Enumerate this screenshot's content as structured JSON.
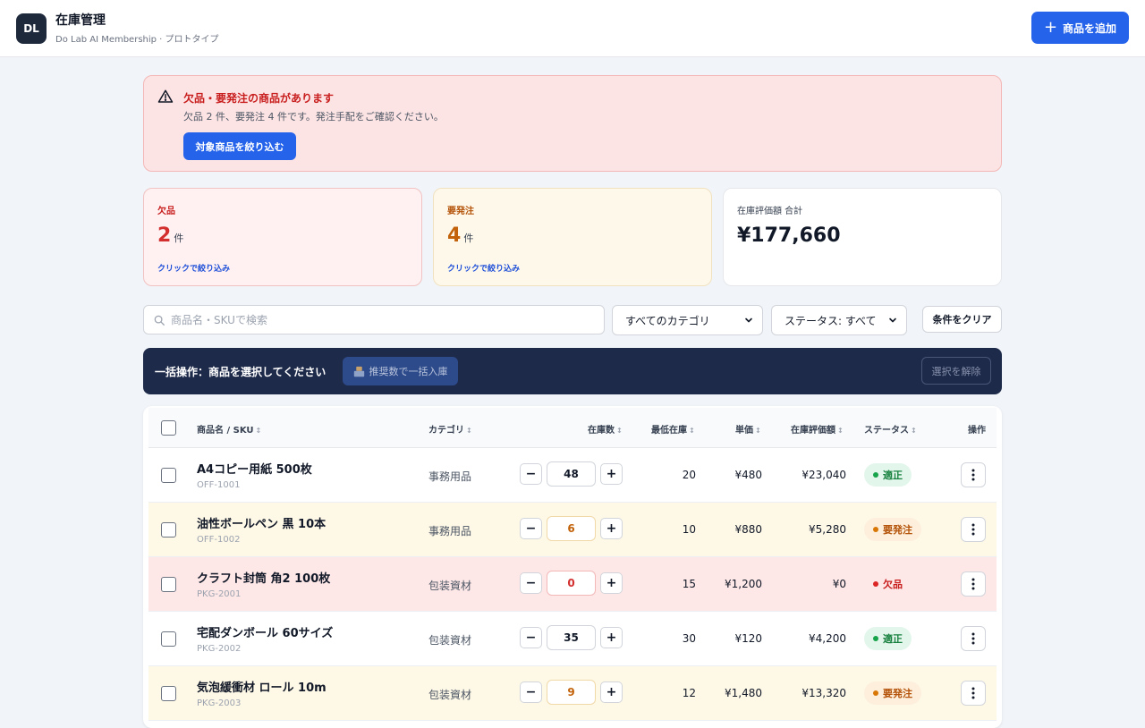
{
  "header": {
    "logo": "DL",
    "title": "在庫管理",
    "subtitle": "Do Lab AI Membership · プロトタイプ",
    "add_button": "商品を追加"
  },
  "alert": {
    "title": "欠品・要発注の商品があります",
    "text": "欠品 2 件、要発注 4 件です。発注手配をご確認ください。",
    "button": "対象商品を絞り込む"
  },
  "cards": {
    "out_of_stock": {
      "label": "欠品",
      "value": "2",
      "unit": "件",
      "link": "クリックで絞り込み"
    },
    "reorder": {
      "label": "要発注",
      "value": "4",
      "unit": "件",
      "link": "クリックで絞り込み"
    },
    "valuation": {
      "label": "在庫評価額 合計",
      "value": "¥177,660"
    }
  },
  "filters": {
    "search_placeholder": "商品名・SKUで検索",
    "category_selected": "すべてのカテゴリ",
    "status_selected": "ステータス: すべて",
    "clear_button": "条件をクリア"
  },
  "bulk": {
    "label": "一括操作：商品を選択してください",
    "restock_button": "推奨数で一括入庫",
    "deselect_button": "選択を解除"
  },
  "table": {
    "columns": {
      "name": "商品名 / SKU",
      "category": "カテゴリ",
      "stock": "在庫数",
      "min_stock": "最低在庫",
      "price": "単価",
      "valuation": "在庫評価額",
      "status": "ステータス",
      "actions": "操作"
    },
    "rows": [
      {
        "name": "A4コピー用紙 500枚",
        "sku": "OFF-1001",
        "category": "事務用品",
        "stock": "48",
        "min": "20",
        "price": "¥480",
        "value": "¥23,040",
        "status": "適正"
      },
      {
        "name": "油性ボールペン 黒 10本",
        "sku": "OFF-1002",
        "category": "事務用品",
        "stock": "6",
        "min": "10",
        "price": "¥880",
        "value": "¥5,280",
        "status": "要発注"
      },
      {
        "name": "クラフト封筒 角2 100枚",
        "sku": "PKG-2001",
        "category": "包装資材",
        "stock": "0",
        "min": "15",
        "price": "¥1,200",
        "value": "¥0",
        "status": "欠品"
      },
      {
        "name": "宅配ダンボール 60サイズ",
        "sku": "PKG-2002",
        "category": "包装資材",
        "stock": "35",
        "min": "30",
        "price": "¥120",
        "value": "¥4,200",
        "status": "適正"
      },
      {
        "name": "気泡緩衝材 ロール 10m",
        "sku": "PKG-2003",
        "category": "包装資材",
        "stock": "9",
        "min": "12",
        "price": "¥1,480",
        "value": "¥13,320",
        "status": "要発注"
      }
    ]
  },
  "colors": {
    "primary": "#2563eb",
    "navy": "#1e2a4a",
    "danger": "#d32f2f",
    "warning": "#c2620a",
    "success": "#15803d"
  }
}
